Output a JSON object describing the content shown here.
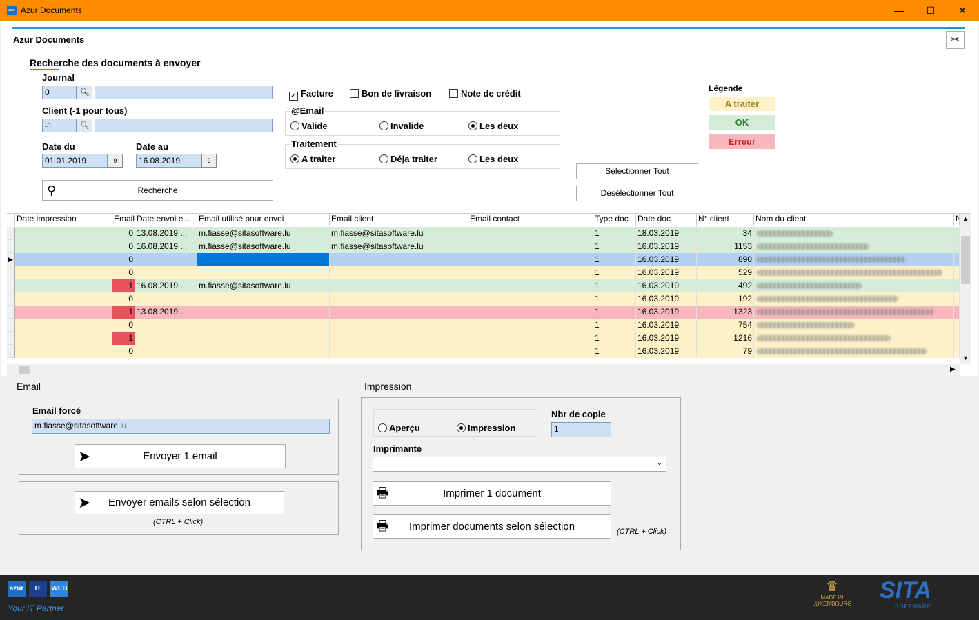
{
  "window": {
    "title": "Azur Documents",
    "minimize": "—",
    "maximize": "☐",
    "close": "✕"
  },
  "app": {
    "title": "Azur Documents",
    "tools_icon": "tools-icon"
  },
  "search": {
    "section_title": "Recherche des documents à envoyer",
    "journal_label": "Journal",
    "journal_value": "0",
    "journal_name": "",
    "client_label": "Client (-1 pour tous)",
    "client_value": "-1",
    "client_name": "",
    "date_from_label": "Date du",
    "date_from_value": "01.01.2019",
    "date_to_label": "Date au",
    "date_to_value": "16.08.2019",
    "date_picker_glyph": "9",
    "search_button": "Recherche"
  },
  "filters": {
    "facture": "Facture",
    "facture_checked": true,
    "bon_livraison": "Bon de livraison",
    "bon_livraison_checked": false,
    "note_credit": "Note de crédit",
    "note_credit_checked": false,
    "email_group_title": "@Email",
    "email_options": [
      "Valide",
      "Invalide",
      "Les deux"
    ],
    "email_selected": 2,
    "traitement_group_title": "Traitement",
    "traitement_options": [
      "A traiter",
      "Déja traiter",
      "Les deux"
    ],
    "traitement_selected": 0,
    "select_all": "Sélectionner Tout",
    "deselect_all": "Désélectionner Tout"
  },
  "legend": {
    "title": "Légende",
    "items": [
      {
        "label": "A traiter",
        "bg": "#fdf1c7",
        "fg": "#a08020"
      },
      {
        "label": "OK",
        "bg": "#d5ecd9",
        "fg": "#2e7d32"
      },
      {
        "label": "Erreur",
        "bg": "#f8b7bf",
        "fg": "#c62828"
      }
    ]
  },
  "grid": {
    "columns": [
      "Date impression",
      "Email",
      "Date envoi e...",
      "Email utilisé pour envoi",
      "Email client",
      "Email contact",
      "Type doc",
      "Date doc",
      "N° client",
      "Nom du client",
      "N"
    ],
    "rows": [
      {
        "state": "ok",
        "email": "0",
        "date_envoi": "13.08.2019 ...",
        "email_used": "m.fiasse@sitasoftware.lu",
        "email_client": "m.fiasse@sitasoftware.lu",
        "type": "1",
        "date_doc": "18.03.2019",
        "client_no": "34"
      },
      {
        "state": "ok",
        "email": "0",
        "date_envoi": "16.08.2019 ...",
        "email_used": "m.fiasse@sitasoftware.lu",
        "email_client": "m.fiasse@sitasoftware.lu",
        "type": "1",
        "date_doc": "16.03.2019",
        "client_no": "1153"
      },
      {
        "state": "selected",
        "email": "0",
        "date_envoi": "",
        "email_used": "",
        "email_client": "",
        "type": "1",
        "date_doc": "16.03.2019",
        "client_no": "890"
      },
      {
        "state": "todo",
        "email": "0",
        "date_envoi": "",
        "email_used": "",
        "email_client": "",
        "type": "1",
        "date_doc": "16.03.2019",
        "client_no": "529"
      },
      {
        "state": "ok",
        "email": "1",
        "date_envoi": "16.08.2019 ...",
        "email_used": "m.fiasse@sitasoftware.lu",
        "email_client": "",
        "type": "1",
        "date_doc": "16.03.2019",
        "client_no": "492"
      },
      {
        "state": "todo",
        "email": "0",
        "date_envoi": "",
        "email_used": "",
        "email_client": "",
        "type": "1",
        "date_doc": "16.03.2019",
        "client_no": "192"
      },
      {
        "state": "error",
        "email": "1",
        "date_envoi": "13.08.2019 ...",
        "email_used": "",
        "email_client": "",
        "type": "1",
        "date_doc": "16.03.2019",
        "client_no": "1323"
      },
      {
        "state": "todo",
        "email": "0",
        "date_envoi": "",
        "email_used": "",
        "email_client": "",
        "type": "1",
        "date_doc": "16.03.2019",
        "client_no": "754"
      },
      {
        "state": "todo",
        "email": "1",
        "date_envoi": "",
        "email_used": "",
        "email_client": "",
        "type": "1",
        "date_doc": "16.03.2019",
        "client_no": "1216"
      },
      {
        "state": "todo",
        "email": "0",
        "date_envoi": "",
        "email_used": "",
        "email_client": "",
        "type": "1",
        "date_doc": "16.03.2019",
        "client_no": "79"
      }
    ],
    "colors": {
      "ok": "#d5ecd9",
      "todo": "#fdf1c7",
      "error": "#f8b7bf",
      "selected": "#b4d2f0",
      "email_flag": "#e8525f",
      "active_cell": "#0078d7"
    }
  },
  "email_panel": {
    "title": "Email",
    "forced_label": "Email forcé",
    "forced_value": "m.fiasse@sitasoftware.lu",
    "send_one": "Envoyer 1 email",
    "send_selection": "Envoyer emails selon sélection",
    "hint": "(CTRL + Click)"
  },
  "print_panel": {
    "title": "Impression",
    "preview": "Aperçu",
    "print": "Impression",
    "mode_selected": 1,
    "copies_label": "Nbr de copie",
    "copies_value": "1",
    "printer_label": "Imprimante",
    "printer_value": "",
    "print_one": "Imprimer 1 document",
    "print_selection": "Imprimer documents selon sélection",
    "hint": "(CTRL + Click)"
  },
  "footer": {
    "logo_azur": "azur",
    "logo_it": "IT",
    "logo_web": "WEB",
    "tagline": "Your IT Partner",
    "made_in": "MADE IN",
    "luxembourg": "LUXEMBOURG",
    "sita": "SITA",
    "software": "SOFTWARE"
  }
}
